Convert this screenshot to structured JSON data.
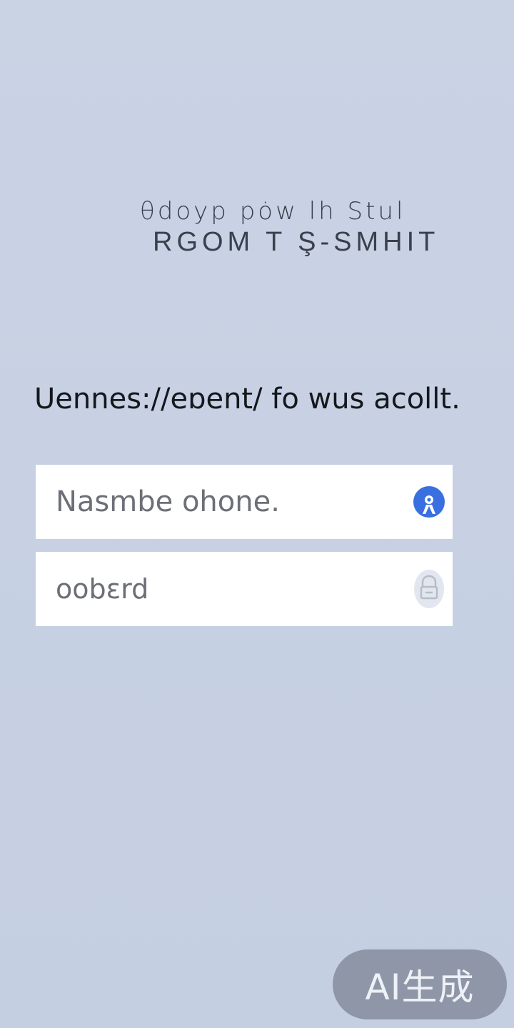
{
  "logo": {
    "line1": "θdoyp  pȯw lh Stul",
    "line2": "RGOM T  Ş-SMHIT"
  },
  "heading": "Uennes://eɒent/ fo wus acollt.",
  "form": {
    "name_field": {
      "value": "Nasmbe ohone.",
      "icon": "location-pin-icon",
      "icon_color": "#3a6fe0"
    },
    "password_field": {
      "value": "oobɛrd",
      "icon": "lock-icon"
    }
  },
  "watermark": {
    "label": "AI生成"
  },
  "colors": {
    "background": "#c8d2e4",
    "field_background": "#ffffff",
    "accent": "#3a6fe0"
  }
}
